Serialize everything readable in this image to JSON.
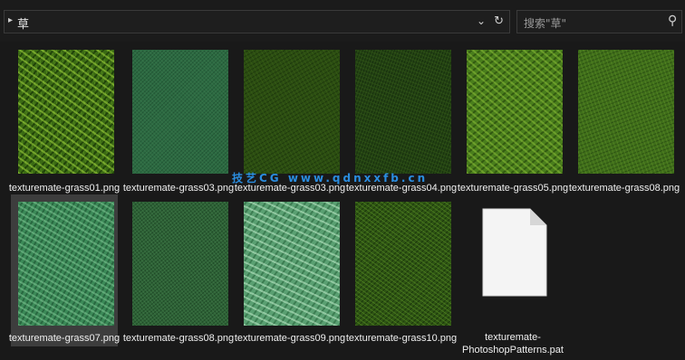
{
  "address_bar": {
    "path": "草",
    "chevron_icon": "chevron-right-icon",
    "dropdown_icon": "chevron-down-icon",
    "refresh_icon": "refresh-icon"
  },
  "search": {
    "placeholder": "搜索\"草\"",
    "icon": "search-icon"
  },
  "files": [
    {
      "name": "texturemate-grass01.png",
      "texture": "hatch"
    },
    {
      "name": "texturemate-grass03.png",
      "texture": "noise-teal"
    },
    {
      "name": "texturemate-grass03.png",
      "texture": "dark"
    },
    {
      "name": "texturemate-grass04.png",
      "texture": "darker"
    },
    {
      "name": "texturemate-grass05.png",
      "texture": "mid"
    },
    {
      "name": "texturemate-grass08.png",
      "texture": "olive"
    },
    {
      "name": "texturemate-grass07.png",
      "texture": "sea",
      "selected": true
    },
    {
      "name": "texturemate-grass08.png",
      "texture": "forest"
    },
    {
      "name": "texturemate-grass09.png",
      "texture": "pale"
    },
    {
      "name": "texturemate-grass10.png",
      "texture": "moss"
    },
    {
      "name": "texturemate-PhotoshopPatterns.pat",
      "texture": "document"
    }
  ],
  "watermark": "技艺CG www.qdnxxfb.cn",
  "colors": {
    "background": "#191919",
    "selection": "#3d3d3d",
    "watermark": "#2a8de0"
  }
}
